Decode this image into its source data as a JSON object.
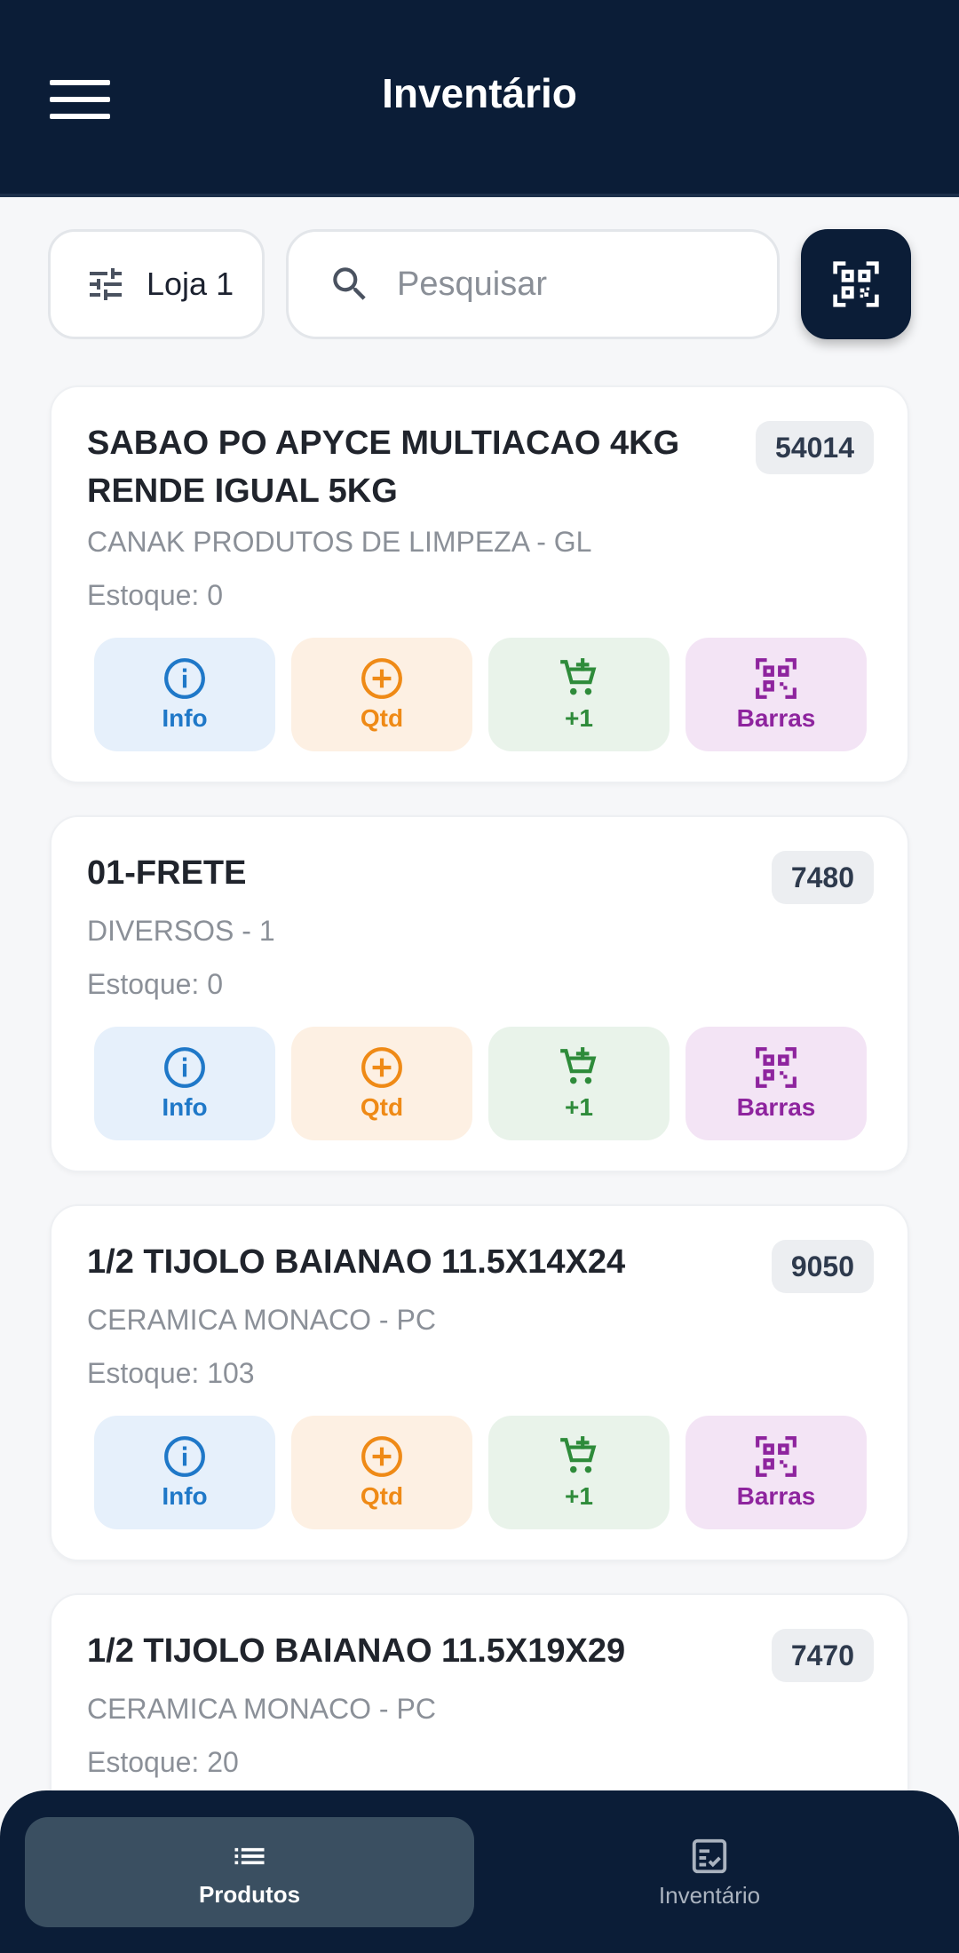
{
  "app_bar": {
    "title": "Inventário"
  },
  "filters": {
    "store_label": "Loja 1",
    "search_placeholder": "Pesquisar",
    "search_value": ""
  },
  "action_labels": {
    "info": "Info",
    "qtd": "Qtd",
    "add_one": "+1",
    "barras": "Barras"
  },
  "products": [
    {
      "name": "SABAO PO APYCE MULTIACAO 4KG RENDE IGUAL 5KG",
      "code": "54014",
      "supplier": "CANAK PRODUTOS DE LIMPEZA - GL",
      "stock": "Estoque: 0"
    },
    {
      "name": "01-FRETE",
      "code": "7480",
      "supplier": "DIVERSOS - 1",
      "stock": "Estoque: 0"
    },
    {
      "name": "1/2 TIJOLO BAIANAO 11.5X14X24",
      "code": "9050",
      "supplier": "CERAMICA MONACO - PC",
      "stock": "Estoque: 103"
    },
    {
      "name": "1/2 TIJOLO BAIANAO 11.5X19X29",
      "code": "7470",
      "supplier": "CERAMICA MONACO - PC",
      "stock": "Estoque: 20"
    }
  ],
  "bottom_nav": {
    "products_label": "Produtos",
    "inventory_label": "Inventário"
  },
  "colors": {
    "primary": "#0b1d37",
    "info": "#1f78c8",
    "qtd": "#ef8a16",
    "cart": "#2e8b3a",
    "barras": "#8e249e"
  }
}
